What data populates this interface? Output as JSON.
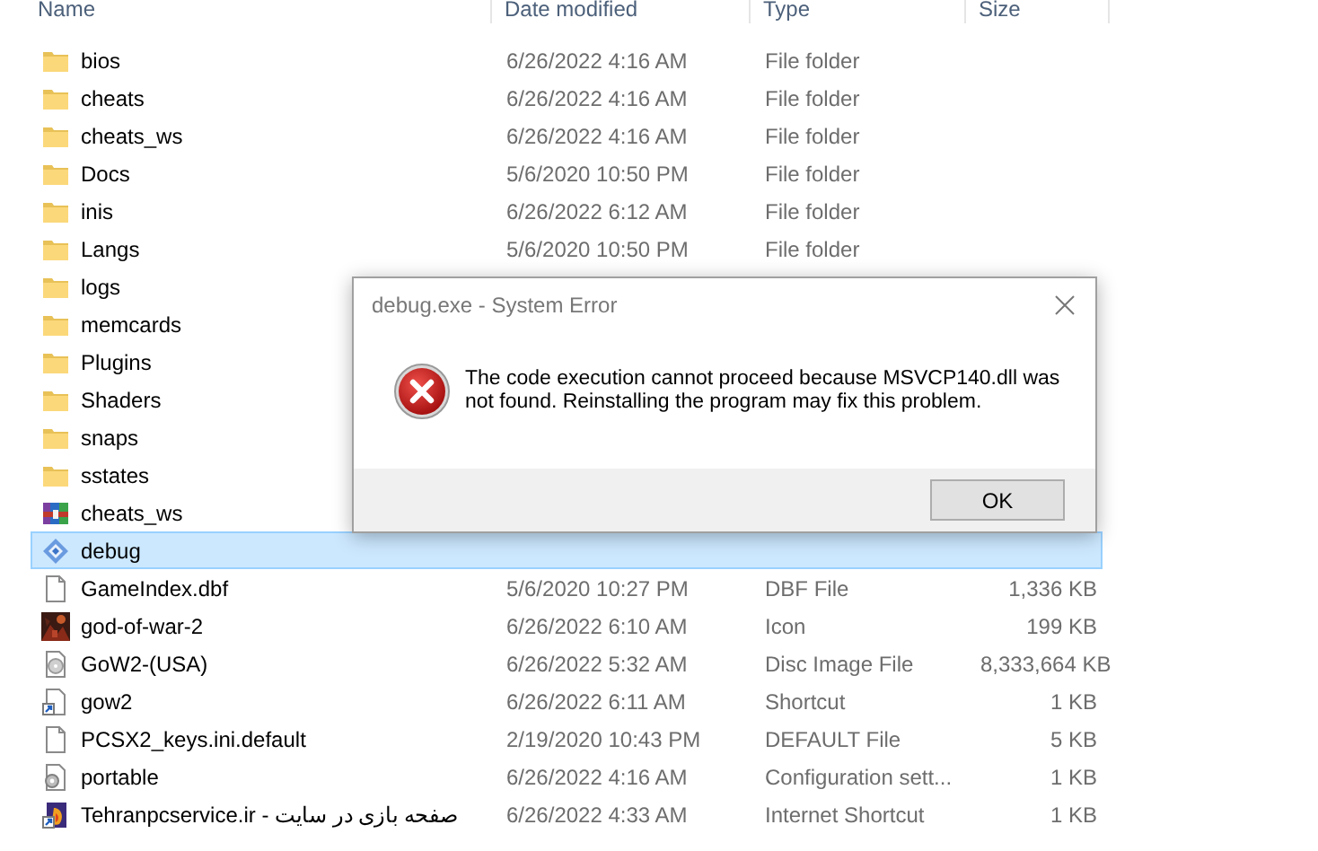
{
  "columns": [
    "Name",
    "Date modified",
    "Type",
    "Size"
  ],
  "rows": [
    {
      "kind": "folder",
      "name": "bios",
      "date": "6/26/2022 4:16 AM",
      "type": "File folder",
      "selected": false
    },
    {
      "kind": "folder",
      "name": "cheats",
      "date": "6/26/2022 4:16 AM",
      "type": "File folder",
      "selected": false
    },
    {
      "kind": "folder",
      "name": "cheats_ws",
      "date": "6/26/2022 4:16 AM",
      "type": "File folder",
      "selected": false
    },
    {
      "kind": "folder",
      "name": "Docs",
      "date": "5/6/2020 10:50 PM",
      "type": "File folder",
      "selected": false
    },
    {
      "kind": "folder",
      "name": "inis",
      "date": "6/26/2022 6:12 AM",
      "type": "File folder",
      "selected": false
    },
    {
      "kind": "folder",
      "name": "Langs",
      "date": "5/6/2020 10:50 PM",
      "type": "File folder",
      "selected": false
    },
    {
      "kind": "folder",
      "name": "logs",
      "selected": false
    },
    {
      "kind": "folder",
      "name": "memcards",
      "selected": false
    },
    {
      "kind": "folder",
      "name": "Plugins",
      "selected": false
    },
    {
      "kind": "folder",
      "name": "Shaders",
      "selected": false
    },
    {
      "kind": "folder",
      "name": "snaps",
      "selected": false
    },
    {
      "kind": "folder",
      "name": "sstates",
      "selected": false
    },
    {
      "kind": "archive",
      "name": "cheats_ws",
      "selected": false
    },
    {
      "kind": "application",
      "name": "debug",
      "selected": true
    },
    {
      "kind": "document",
      "name": "GameIndex.dbf",
      "date": "5/6/2020 10:27 PM",
      "type": "DBF File",
      "size": "1,336 KB",
      "selected": false
    },
    {
      "name": "god-of-war-2",
      "date": "6/26/2022 6:10 AM",
      "type": "Icon",
      "size": "199 KB",
      "selected": false
    },
    {
      "kind": "disc",
      "name": "GoW2-(USA)",
      "date": "6/26/2022 5:32 AM",
      "type": "Disc Image File",
      "size": "8,333,664 KB",
      "selected": false
    },
    {
      "kind": "shortcut",
      "name": "gow2",
      "date": "6/26/2022 6:11 AM",
      "type": "Shortcut",
      "size": "1 KB",
      "selected": false
    },
    {
      "kind": "document",
      "name": "PCSX2_keys.ini.default",
      "date": "2/19/2020 10:43 PM",
      "type": "DEFAULT File",
      "size": "5 KB",
      "selected": false
    },
    {
      "kind": "settings",
      "name": "portable",
      "date": "6/26/2022 4:16 AM",
      "type": "Configuration sett...",
      "size": "1 KB",
      "selected": false
    },
    {
      "kind": "internet-shortcut",
      "name": "Tehranpcservice.ir - صفحه بازی در سایت",
      "date": "6/26/2022 4:33 AM",
      "type": "Internet Shortcut",
      "size": "1 KB",
      "selected": false
    }
  ],
  "dialog": {
    "title": "debug.exe - System Error",
    "message": "The code execution cannot proceed because MSVCP140.dll was not found. Reinstalling the program may fix this problem.",
    "buttons": [
      "OK"
    ]
  }
}
